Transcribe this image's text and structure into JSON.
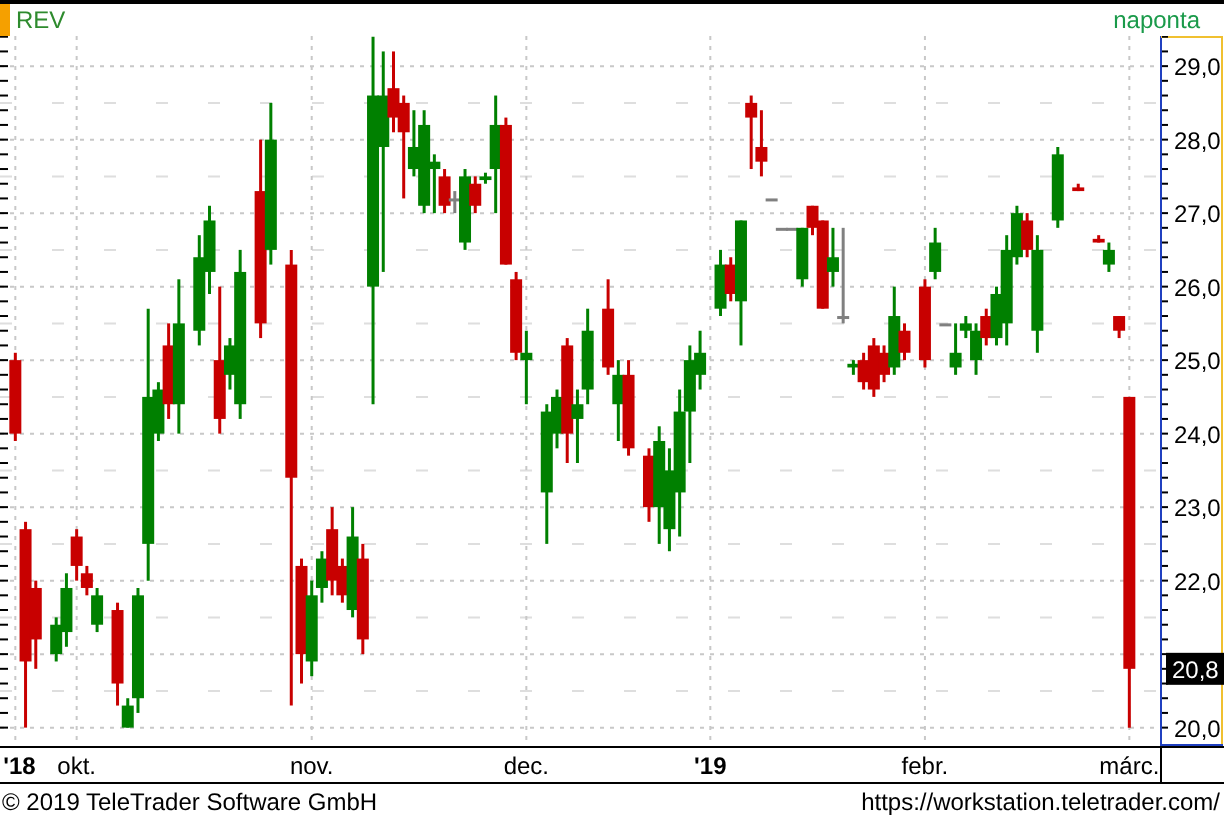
{
  "header": {
    "symbol": "REV",
    "interval": "naponta"
  },
  "chart": {
    "chart_data": {
      "type": "candlestick",
      "grid": true,
      "ylim": [
        19.75,
        29.41
      ],
      "yticks": [
        {
          "value": 20,
          "label": "20,0"
        },
        {
          "value": 22,
          "label": "22,0"
        },
        {
          "value": 23,
          "label": "23,0"
        },
        {
          "value": 24,
          "label": "24,0"
        },
        {
          "value": 25,
          "label": "25,0"
        },
        {
          "value": 26,
          "label": "26,0"
        },
        {
          "value": 27,
          "label": "27,0"
        },
        {
          "value": 28,
          "label": "28,0"
        },
        {
          "value": 29,
          "label": "29,0"
        }
      ],
      "categories": [
        "'18",
        null,
        null,
        null,
        null,
        null,
        "okt.",
        null,
        null,
        null,
        null,
        null,
        null,
        null,
        null,
        null,
        null,
        null,
        null,
        null,
        null,
        null,
        null,
        null,
        null,
        null,
        null,
        null,
        null,
        "nov.",
        null,
        null,
        null,
        null,
        null,
        null,
        null,
        null,
        null,
        null,
        null,
        null,
        null,
        null,
        null,
        null,
        null,
        null,
        null,
        null,
        "dec.",
        null,
        null,
        null,
        null,
        null,
        null,
        null,
        null,
        null,
        null,
        null,
        null,
        null,
        null,
        null,
        null,
        null,
        "'19",
        null,
        null,
        null,
        null,
        null,
        null,
        null,
        null,
        null,
        null,
        null,
        null,
        null,
        null,
        null,
        null,
        null,
        null,
        null,
        null,
        "febr.",
        null,
        null,
        null,
        null,
        null,
        null,
        null,
        null,
        null,
        null,
        null,
        null,
        null,
        null,
        null,
        null,
        null,
        null,
        null,
        "márc."
      ],
      "ohlc": [
        [
          25.0,
          25.1,
          23.9,
          24.0
        ],
        [
          22.7,
          22.8,
          20.0,
          20.9
        ],
        [
          21.9,
          22.0,
          20.8,
          21.2
        ],
        null,
        [
          21.0,
          21.5,
          20.9,
          21.4
        ],
        [
          21.3,
          22.1,
          21.1,
          21.9
        ],
        [
          22.6,
          22.7,
          22.0,
          22.2
        ],
        [
          22.1,
          22.2,
          21.8,
          21.9
        ],
        [
          21.4,
          21.9,
          21.3,
          21.8
        ],
        null,
        [
          21.6,
          21.7,
          20.3,
          20.6
        ],
        [
          20.0,
          20.4,
          20.0,
          20.3
        ],
        [
          20.4,
          21.9,
          20.2,
          21.8
        ],
        [
          22.5,
          25.7,
          22.0,
          24.5
        ],
        [
          24.0,
          24.7,
          23.9,
          24.6
        ],
        [
          25.2,
          25.5,
          24.2,
          24.4
        ],
        [
          24.4,
          26.1,
          24.0,
          25.5
        ],
        null,
        [
          25.4,
          26.7,
          25.2,
          26.4
        ],
        [
          26.2,
          27.1,
          25.9,
          26.9
        ],
        [
          25.0,
          26.0,
          24.0,
          24.2
        ],
        [
          24.8,
          25.3,
          24.6,
          25.2
        ],
        [
          24.4,
          26.5,
          24.2,
          26.2
        ],
        null,
        [
          27.3,
          28.0,
          25.3,
          25.5
        ],
        [
          26.5,
          28.5,
          26.3,
          28.0
        ],
        null,
        [
          26.3,
          26.5,
          20.3,
          23.4
        ],
        [
          22.2,
          22.3,
          20.6,
          21.0
        ],
        [
          20.9,
          22.0,
          20.7,
          21.8
        ],
        [
          21.9,
          22.4,
          21.7,
          22.3
        ],
        [
          22.7,
          23.0,
          21.8,
          22.0
        ],
        [
          22.2,
          22.3,
          21.7,
          21.8
        ],
        [
          21.6,
          23.0,
          21.5,
          22.6
        ],
        [
          22.3,
          22.5,
          21.0,
          21.2
        ],
        [
          26.0,
          29.4,
          24.4,
          28.6
        ],
        [
          27.9,
          29.2,
          26.2,
          28.6
        ],
        [
          28.7,
          29.2,
          28.1,
          28.3
        ],
        [
          28.5,
          28.6,
          27.2,
          28.1
        ],
        [
          27.6,
          28.4,
          27.5,
          27.9
        ],
        [
          27.1,
          28.4,
          27.0,
          28.2
        ],
        [
          27.6,
          27.8,
          27.0,
          27.7
        ],
        [
          27.5,
          27.6,
          27.0,
          27.1
        ],
        [
          27.2,
          27.3,
          27.0,
          27.2
        ],
        [
          26.6,
          27.6,
          26.5,
          27.5
        ],
        [
          27.4,
          27.5,
          27.0,
          27.1
        ],
        [
          27.45,
          27.55,
          27.4,
          27.5
        ],
        [
          27.6,
          28.6,
          27.0,
          28.2
        ],
        [
          28.2,
          28.3,
          26.3,
          26.3
        ],
        [
          26.1,
          26.2,
          25.0,
          25.1
        ],
        [
          25.0,
          25.4,
          24.4,
          25.1
        ],
        null,
        [
          23.2,
          24.4,
          22.5,
          24.3
        ],
        [
          24.0,
          24.6,
          23.8,
          24.5
        ],
        [
          25.2,
          25.3,
          23.6,
          24.0
        ],
        [
          24.2,
          24.6,
          23.6,
          24.4
        ],
        [
          24.6,
          25.7,
          24.4,
          25.4
        ],
        null,
        [
          25.7,
          26.1,
          24.8,
          24.9
        ],
        [
          24.4,
          25.0,
          23.9,
          24.8
        ],
        [
          24.8,
          25.0,
          23.7,
          23.8
        ],
        null,
        [
          23.7,
          23.8,
          22.8,
          23.0
        ],
        [
          23.0,
          24.1,
          22.5,
          23.9
        ],
        [
          22.7,
          23.8,
          22.4,
          23.5
        ],
        [
          23.2,
          24.6,
          22.6,
          24.3
        ],
        [
          24.3,
          25.2,
          23.6,
          25.0
        ],
        [
          24.8,
          25.4,
          24.6,
          25.1
        ],
        null,
        [
          25.7,
          26.5,
          25.6,
          26.3
        ],
        [
          26.3,
          26.4,
          25.8,
          25.9
        ],
        [
          25.8,
          26.9,
          25.2,
          26.9
        ],
        [
          28.5,
          28.6,
          27.6,
          28.3
        ],
        [
          27.9,
          28.4,
          27.5,
          27.7
        ],
        [
          27.2,
          27.2,
          27.2,
          27.2
        ],
        [
          26.8,
          26.8,
          26.8,
          26.8
        ],
        [
          26.8,
          26.8,
          26.8,
          26.8
        ],
        [
          26.1,
          26.8,
          26.0,
          26.8
        ],
        [
          27.1,
          27.1,
          26.7,
          26.8
        ],
        [
          26.9,
          26.9,
          25.7,
          25.7
        ],
        [
          26.2,
          26.8,
          26.0,
          26.4
        ],
        [
          25.6,
          26.8,
          25.5,
          25.6
        ],
        [
          24.9,
          25.0,
          24.8,
          24.95
        ],
        [
          25.0,
          25.1,
          24.6,
          24.7
        ],
        [
          25.2,
          25.3,
          24.5,
          24.6
        ],
        [
          25.1,
          25.2,
          24.7,
          24.8
        ],
        [
          24.9,
          26.0,
          24.8,
          25.6
        ],
        [
          25.4,
          25.5,
          25.0,
          25.1
        ],
        null,
        [
          26.0,
          26.1,
          24.9,
          25.0
        ],
        [
          26.2,
          26.8,
          26.1,
          26.6
        ],
        [
          25.5,
          25.5,
          25.5,
          25.5
        ],
        [
          24.9,
          25.5,
          24.8,
          25.1
        ],
        [
          25.4,
          25.6,
          25.3,
          25.5
        ],
        [
          25.0,
          25.5,
          24.8,
          25.4
        ],
        [
          25.6,
          25.7,
          25.2,
          25.3
        ],
        [
          25.3,
          26.0,
          25.2,
          25.9
        ],
        [
          25.5,
          26.7,
          25.2,
          26.5
        ],
        [
          26.4,
          27.1,
          26.3,
          27.0
        ],
        [
          26.9,
          27.0,
          26.4,
          26.5
        ],
        [
          25.4,
          26.7,
          25.1,
          26.5
        ],
        null,
        [
          26.9,
          27.9,
          26.8,
          27.8
        ],
        null,
        [
          27.35,
          27.4,
          27.3,
          27.3
        ],
        null,
        [
          26.65,
          26.7,
          26.6,
          26.6
        ],
        [
          26.3,
          26.6,
          26.2,
          26.5
        ],
        [
          25.6,
          25.6,
          25.3,
          25.4
        ],
        [
          24.5,
          24.5,
          20.0,
          20.8
        ]
      ]
    },
    "price_tag": "20,8"
  },
  "footer": {
    "copyright": "© 2019 TeleTrader Software GmbH",
    "url": "https://workstation.teletrader.com/"
  }
}
